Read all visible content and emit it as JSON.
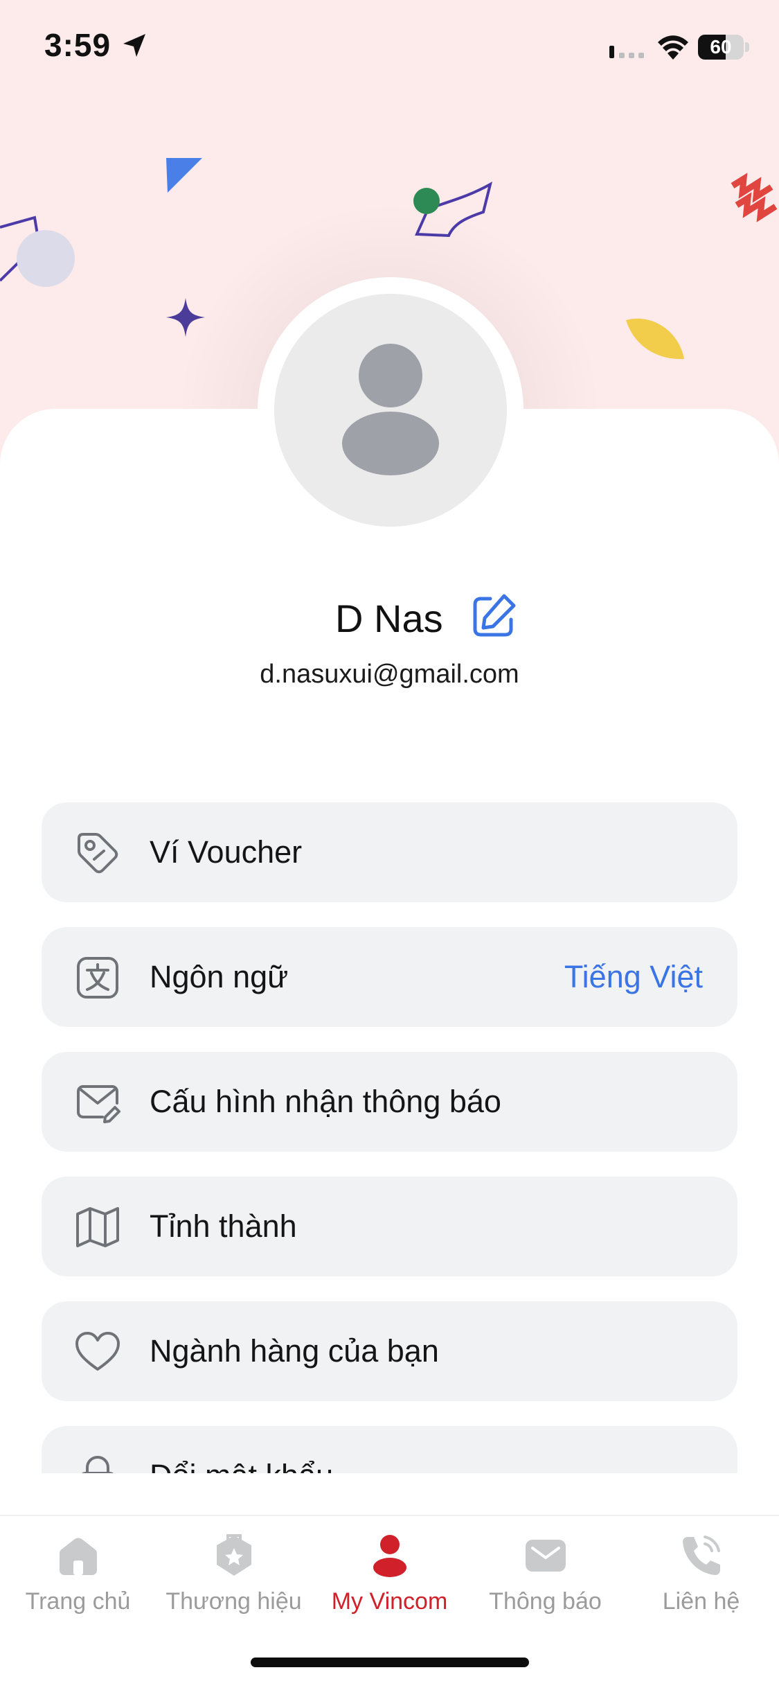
{
  "status_bar": {
    "time": "3:59",
    "battery_level": "60",
    "battery_fraction": 0.6,
    "icons": [
      "location-arrow-icon",
      "cellular-signal-icon",
      "wifi-icon",
      "battery-icon"
    ]
  },
  "profile": {
    "name": "D Nas",
    "email": "d.nasuxui@gmail.com",
    "avatar_icon": "default-user-avatar-icon",
    "edit_icon": "edit-pencil-icon"
  },
  "menu": {
    "items": [
      {
        "label": "Ví Voucher",
        "icon": "voucher-tag-icon"
      },
      {
        "label": "Ngôn ngữ",
        "icon": "translate-icon",
        "value": "Tiếng Việt"
      },
      {
        "label": "Cấu hình nhận thông báo",
        "icon": "mail-settings-icon"
      },
      {
        "label": "Tỉnh thành",
        "icon": "map-icon"
      },
      {
        "label": "Ngành hàng của bạn",
        "icon": "heart-icon"
      },
      {
        "label": "Đổi mật khẩu",
        "icon": "lock-icon"
      }
    ]
  },
  "tab_bar": {
    "tabs": [
      {
        "label": "Trang chủ",
        "icon": "home-icon",
        "active": false
      },
      {
        "label": "Thương hiệu",
        "icon": "brand-badge-icon",
        "active": false
      },
      {
        "label": "My Vincom",
        "icon": "person-icon",
        "active": true
      },
      {
        "label": "Thông báo",
        "icon": "envelope-icon",
        "active": false
      },
      {
        "label": "Liên hệ",
        "icon": "phone-icon",
        "active": false
      }
    ]
  },
  "colors": {
    "header_background": "#fdeaea",
    "accent_red": "#d0202a",
    "link_blue": "#3b74e4",
    "menu_item_background": "#f1f2f4",
    "inactive_tab": "#9b9b9b"
  }
}
